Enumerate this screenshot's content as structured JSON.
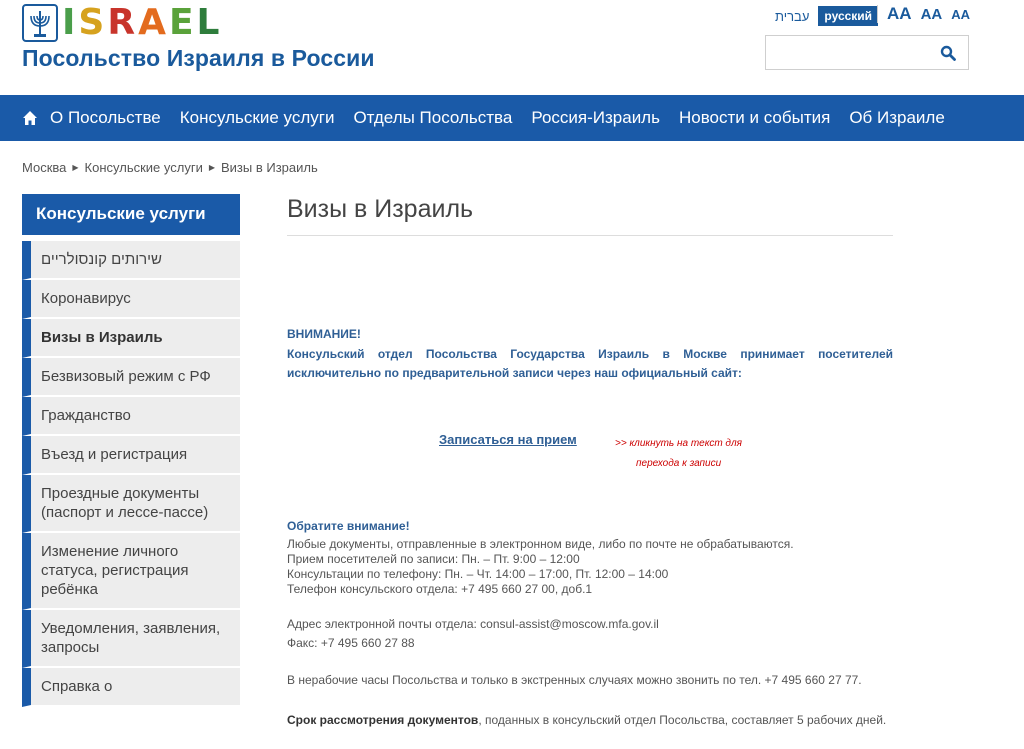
{
  "header": {
    "logo_letters": [
      "I",
      "S",
      "R",
      "A",
      "E",
      "L"
    ],
    "logo_colors": [
      "#4a9e4a",
      "#d6a21e",
      "#c8342b",
      "#e36b1e",
      "#5aa23a",
      "#2e7d3c"
    ],
    "site_title": "Посольство Израиля в России",
    "lang_hebrew": "עברית",
    "lang_russian": "русский",
    "font_size_large": "AA",
    "font_size_medium": "AA",
    "font_size_small": "AA",
    "search_placeholder": ""
  },
  "nav": {
    "items": [
      "О Посольстве",
      "Консульские услуги",
      "Отделы Посольства",
      "Россия-Израиль",
      "Новости и события",
      "Об Израиле"
    ]
  },
  "breadcrumb": [
    "Москва",
    "Консульские услуги",
    "Визы в Израиль"
  ],
  "sidebar": {
    "title": "Консульские услуги",
    "items": [
      "שירותים קונסולריים",
      "Коронавирус",
      "Визы в Израиль",
      "Безвизовый режим с РФ",
      "Гражданство",
      "Въезд и регистрация",
      "Проездные документы (паспорт и лессе-пассе)",
      "Изменение личного статуса, регистрация ребёнка",
      "Уведомления, заявления, запросы",
      "Справка о"
    ],
    "active_index": 2
  },
  "main": {
    "title": "Визы в Израиль",
    "attention_heading": "ВНИМАНИЕ!",
    "attention_body": "Консульский отдел Посольства Государства Израиль в Москве принимает посетителей исключительно по предварительной записи через наш официальный сайт:",
    "signup_link": "Записаться на прием",
    "click_hint_line1": ">> кликнуть на текст для",
    "click_hint_line2": "перехода к записи",
    "note_heading": "Обратите внимание!",
    "note_lines": [
      "Любые документы, отправленные в электронном виде, либо по почте не обрабатываются.",
      "Прием посетителей по записи: Пн. – Пт. 9:00 – 12:00",
      "Консультации по телефону: Пн. – Чт. 14:00 – 17:00, Пт. 12:00 – 14:00",
      "Телефон консульского отдела: +7 495 660 27 00, доб.1",
      "Адрес электронной почты отдела: consul-assist@moscow.mfa.gov.il",
      "Факс: +7 495 660 27 88",
      "В нерабочие часы Посольства и только в экстренных случаях можно звонить по тел. +7 495 660 27 77."
    ],
    "deadline_bold": "Срок рассмотрения документов",
    "deadline_rest": ", поданных в консульский отдел Посольства, составляет 5 рабочих дней."
  }
}
